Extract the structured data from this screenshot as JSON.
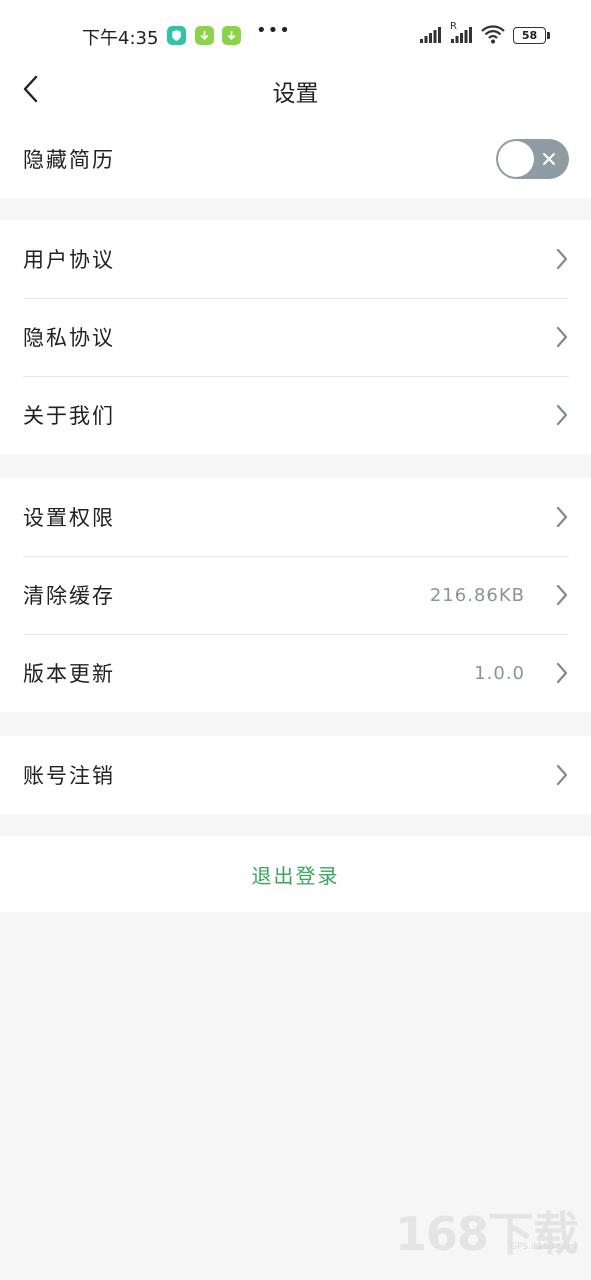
{
  "status_bar": {
    "time": "下午4:35",
    "more": "•••",
    "battery": "58",
    "roaming": "R"
  },
  "nav": {
    "title": "设置"
  },
  "hide_resume": {
    "label": "隐藏简历",
    "enabled": false
  },
  "group1": [
    {
      "label": "用户协议"
    },
    {
      "label": "隐私协议"
    },
    {
      "label": "关于我们"
    }
  ],
  "group2": [
    {
      "label": "设置权限",
      "value": ""
    },
    {
      "label": "清除缓存",
      "value": "216.86KB"
    },
    {
      "label": "版本更新",
      "value": "1.0.0"
    }
  ],
  "group3": [
    {
      "label": "账号注销"
    }
  ],
  "logout_label": "退出登录",
  "watermark": {
    "main": "168下载",
    "sub": "GPS.it168.com"
  },
  "colors": {
    "accent_green": "#3aa65a",
    "toggle_off": "#909ca4",
    "page_bg": "#f6f6f6"
  }
}
